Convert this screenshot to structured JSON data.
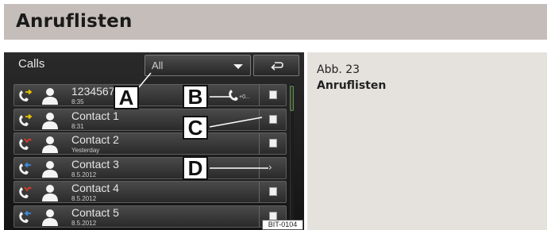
{
  "header": {
    "title": "Anruflisten"
  },
  "figure": {
    "number": "Abb. 23",
    "caption": "Anruflisten"
  },
  "screen": {
    "calls_label": "Calls",
    "filter": {
      "selected": "All"
    },
    "back_icon": "return-arrow-icon",
    "rows": [
      {
        "name": "12345678",
        "when": "8:35",
        "call_type": "outgoing",
        "icon_color": "#e8c400",
        "end": "square",
        "extra_label": "+0..."
      },
      {
        "name": "Contact 1",
        "when": "8:31",
        "call_type": "outgoing",
        "icon_color": "#e8c400",
        "end": "square"
      },
      {
        "name": "Contact 2",
        "when": "Yesterday",
        "call_type": "missed",
        "icon_color": "#e23a2a",
        "end": "square"
      },
      {
        "name": "Contact 3",
        "when": "8.5.2012",
        "call_type": "incoming",
        "icon_color": "#3a8ee0",
        "end": "chevron"
      },
      {
        "name": "Contact 4",
        "when": "8.5.2012",
        "call_type": "missed",
        "icon_color": "#e23a2a",
        "end": "square"
      },
      {
        "name": "Contact 5",
        "when": "8.5.2012",
        "call_type": "incoming",
        "icon_color": "#3a8ee0",
        "end": "square"
      }
    ]
  },
  "callouts": [
    "A",
    "B",
    "C",
    "D"
  ],
  "image_code": "BIT-0104"
}
